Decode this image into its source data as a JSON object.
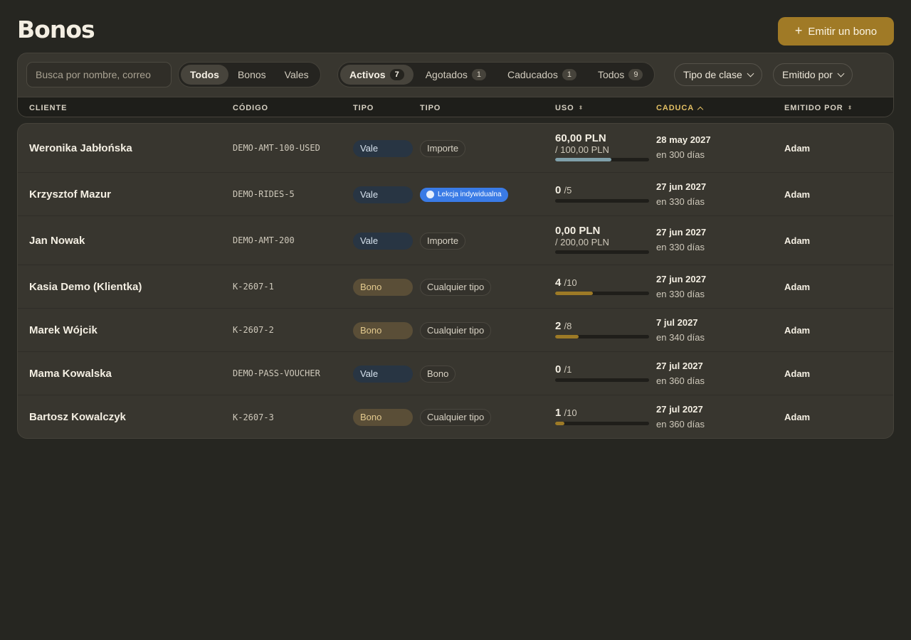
{
  "page": {
    "title": "Bonos"
  },
  "actions": {
    "issue_label": "Emitir un bono",
    "issue_icon": "plus-icon"
  },
  "filters": {
    "search_placeholder": "Busca por nombre, correo",
    "kind_tabs": [
      {
        "label": "Todos",
        "active": true
      },
      {
        "label": "Bonos",
        "active": false
      },
      {
        "label": "Vales",
        "active": false
      }
    ],
    "status_tabs": [
      {
        "label": "Activos",
        "count": "7",
        "active": true
      },
      {
        "label": "Agotados",
        "count": "1",
        "active": false
      },
      {
        "label": "Caducados",
        "count": "1",
        "active": false
      },
      {
        "label": "Todos",
        "count": "9",
        "active": false
      }
    ],
    "class_type_label": "Tipo de clase",
    "issued_by_label": "Emitido por"
  },
  "table": {
    "columns": {
      "client": "CLIENTE",
      "code": "CÓDIGO",
      "kind": "TIPO",
      "type": "TIPO",
      "usage": "USO",
      "expires": "CADUCA",
      "issued_by": "EMITIDO POR"
    },
    "sorted_column": "expires",
    "sort_direction": "ascending",
    "rows": [
      {
        "client": "Weronika Jabłońska",
        "code": "DEMO-AMT-100-USED",
        "kind": "Vale",
        "type": "Importe",
        "usage_main": "60,00 PLN",
        "usage_of": "",
        "usage_sub": "/ 100,00 PLN",
        "usage_fraction": 0.6,
        "bar_color": "#7fa0aa",
        "expires": "28 may 2027",
        "expires_rel": "en 300 días",
        "issued_by": "Adam"
      },
      {
        "client": "Krzysztof Mazur",
        "code": "DEMO-RIDES-5",
        "kind": "Vale",
        "type": "Lekcja indywidualna",
        "usage_main": "0",
        "usage_of": "/5",
        "usage_sub": "",
        "usage_fraction": 0,
        "bar_color": "#9d7a26",
        "expires": "27 jun 2027",
        "expires_rel": "en 330 días",
        "issued_by": "Adam"
      },
      {
        "client": "Jan Nowak",
        "code": "DEMO-AMT-200",
        "kind": "Vale",
        "type": "Importe",
        "usage_main": "0,00 PLN",
        "usage_of": "",
        "usage_sub": "/ 200,00 PLN",
        "usage_fraction": 0,
        "bar_color": "#7fa0aa",
        "expires": "27 jun 2027",
        "expires_rel": "en 330 días",
        "issued_by": "Adam"
      },
      {
        "client": "Kasia Demo (Klientka)",
        "code": "K-2607-1",
        "kind": "Bono",
        "type": "Cualquier tipo",
        "usage_main": "4",
        "usage_of": "/10",
        "usage_sub": "",
        "usage_fraction": 0.4,
        "bar_color": "#9d7a26",
        "expires": "27 jun 2027",
        "expires_rel": "en 330 días",
        "issued_by": "Adam"
      },
      {
        "client": "Marek Wójcik",
        "code": "K-2607-2",
        "kind": "Bono",
        "type": "Cualquier tipo",
        "usage_main": "2",
        "usage_of": "/8",
        "usage_sub": "",
        "usage_fraction": 0.25,
        "bar_color": "#9d7a26",
        "expires": "7 jul 2027",
        "expires_rel": "en 340 días",
        "issued_by": "Adam"
      },
      {
        "client": "Mama Kowalska",
        "code": "DEMO-PASS-VOUCHER",
        "kind": "Vale",
        "type": "Bono",
        "usage_main": "0",
        "usage_of": "/1",
        "usage_sub": "",
        "usage_fraction": 0,
        "bar_color": "#9d7a26",
        "expires": "27 jul 2027",
        "expires_rel": "en 360 días",
        "issued_by": "Adam"
      },
      {
        "client": "Bartosz Kowalczyk",
        "code": "K-2607-3",
        "kind": "Bono",
        "type": "Cualquier tipo",
        "usage_main": "1",
        "usage_of": "/10",
        "usage_sub": "",
        "usage_fraction": 0.1,
        "bar_color": "#9d7a26",
        "expires": "27 jul 2027",
        "expires_rel": "en 360 días",
        "issued_by": "Adam"
      }
    ]
  }
}
